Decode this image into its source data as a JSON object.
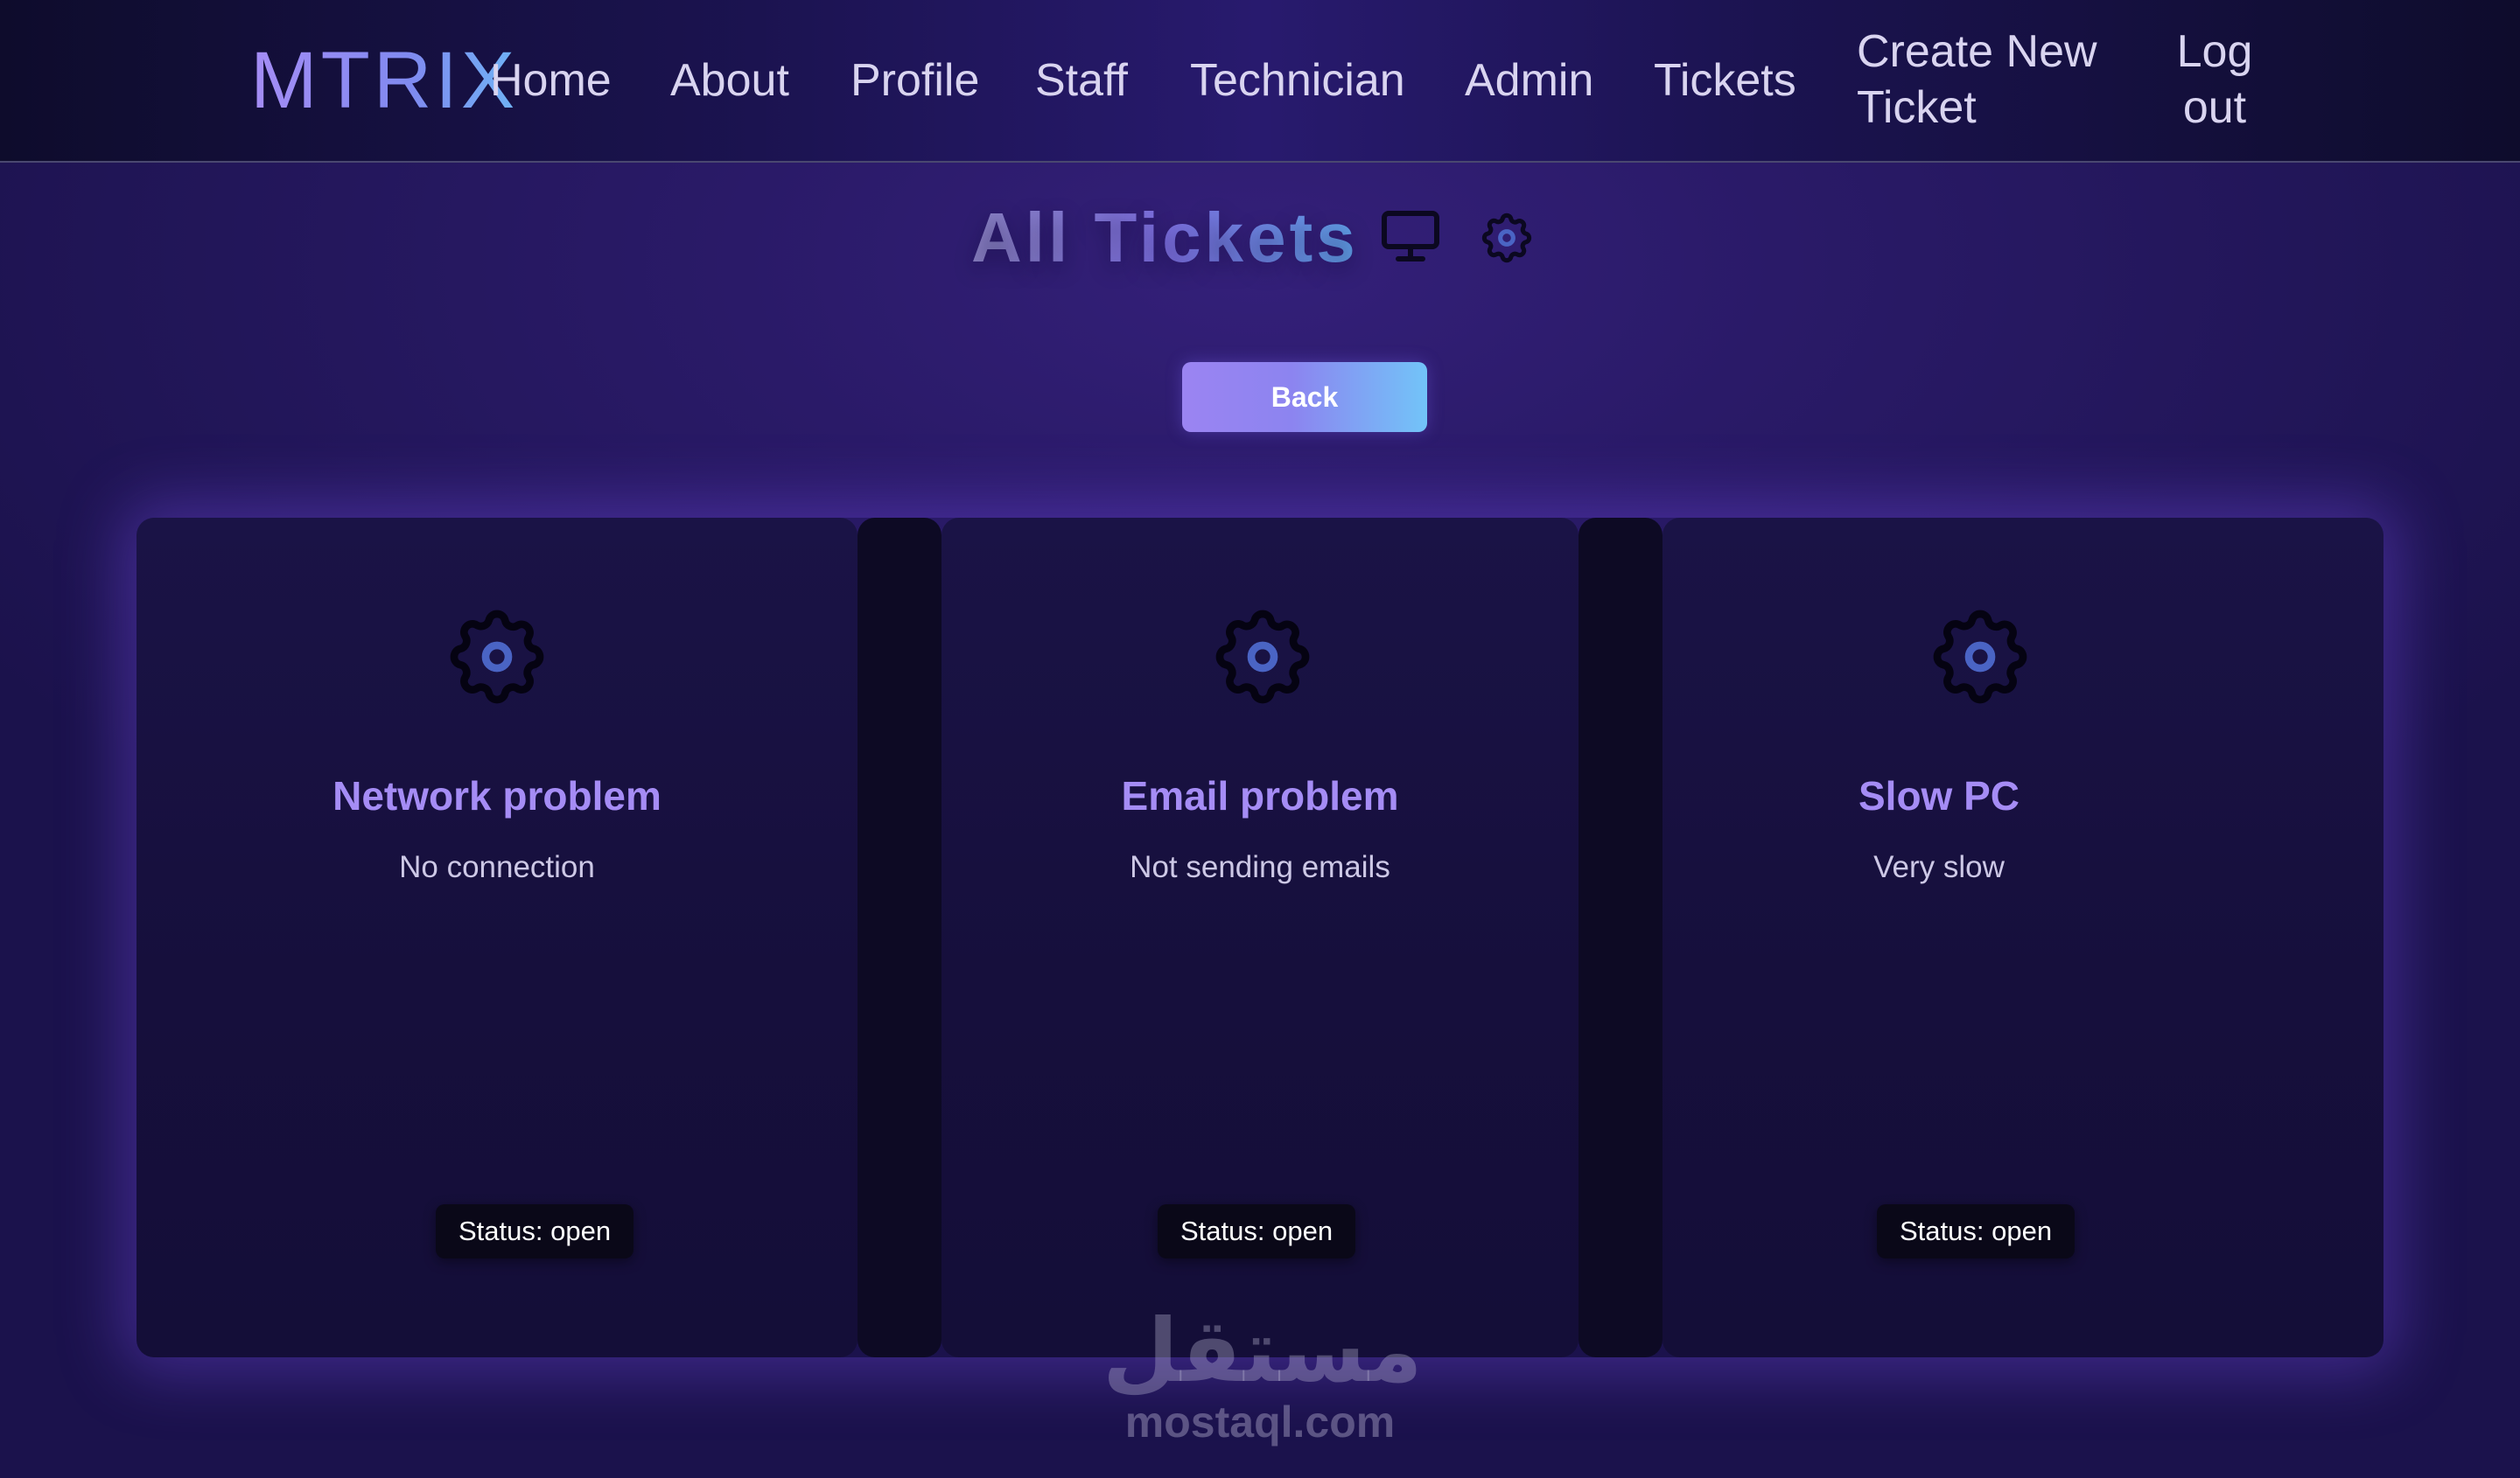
{
  "app": {
    "logo": "MTRIX"
  },
  "nav": {
    "home": "Home",
    "about": "About",
    "profile": "Profile",
    "staff": "Staff",
    "technician": "Technician",
    "admin": "Admin",
    "tickets": "Tickets",
    "create_line1": "Create New",
    "create_line2": "Ticket",
    "logout_line1": "Log",
    "logout_line2": "out"
  },
  "header": {
    "title": "All Tickets",
    "icons": [
      "monitor-icon",
      "gear-icon"
    ]
  },
  "actions": {
    "back_label": "Back"
  },
  "tickets": [
    {
      "title": "Network problem",
      "description": "No connection",
      "status": "Status: open",
      "icon": "gear-icon"
    },
    {
      "title": "Email problem",
      "description": "Not sending emails",
      "status": "Status: open",
      "icon": "gear-icon"
    },
    {
      "title": "Slow PC",
      "description": "Very slow",
      "status": "Status: open",
      "icon": "gear-icon"
    }
  ],
  "watermark": {
    "arabic": "مستقل",
    "domain": "mostaql.com"
  },
  "colors": {
    "accent_purple": "#a58cf5",
    "accent_blue": "#72c4f8",
    "background": "#2a1a68",
    "card_background": "#160f3c",
    "badge_background": "#0a0818",
    "icon_inner": "#4a64c4"
  }
}
